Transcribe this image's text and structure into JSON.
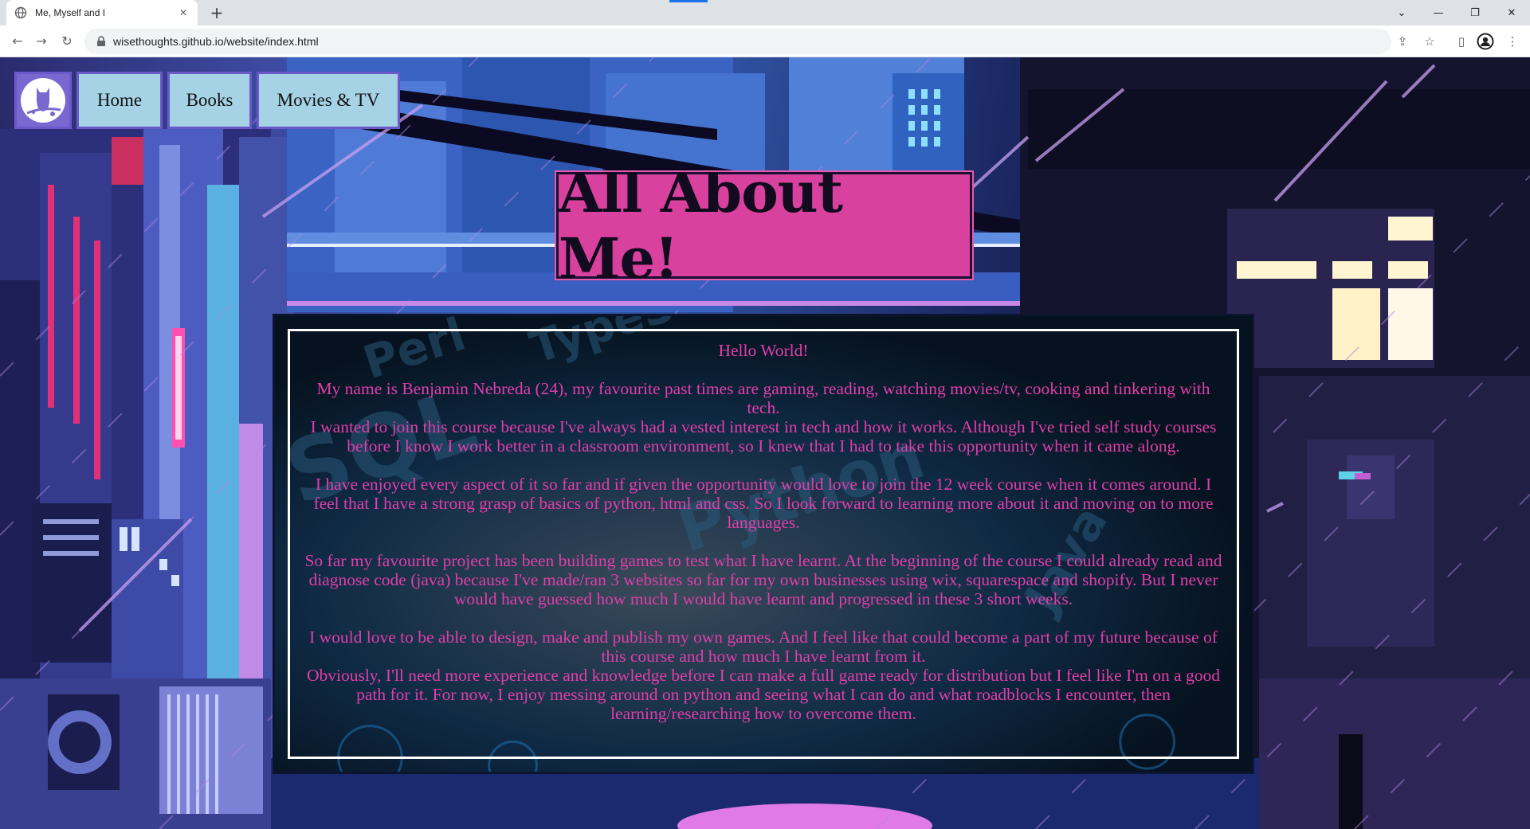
{
  "browser": {
    "tab_title": "Me, Myself and I",
    "tab_close_glyph": "✕",
    "new_tab_glyph": "+",
    "url": "wisethoughts.github.io/website/index.html",
    "window_controls": [
      "⌄",
      "—",
      "❐",
      "✕"
    ],
    "nav_glyphs": {
      "back": "←",
      "forward": "→",
      "reload": "↻"
    },
    "toolbar_glyphs": {
      "share": "⇪",
      "bookmark": "☆",
      "sidepanel": "▯",
      "menu": "⋮"
    }
  },
  "nav": {
    "logo_icon": "owl-icon",
    "items": [
      {
        "label": "Home"
      },
      {
        "label": "Books"
      },
      {
        "label": "Movies & TV"
      }
    ]
  },
  "header": {
    "title": "All About Me!"
  },
  "content": {
    "greeting": "Hello World!",
    "p1a": "My name is Benjamin Nebreda (24), my favourite past times are gaming, reading, watching movies/tv, cooking and tinkering with tech.",
    "p1b": "I wanted to join this course because I've always had a vested interest in tech and how it works. Although I've tried self study courses before I know I work better in a classroom environment, so I knew that I had to take this opportunity when it came along.",
    "p2": "I have enjoyed every aspect of it so far and if given the opportunity would love to join the 12 week course when it comes around. I feel that I have a strong grasp of basics of python, html and css. So I look forward to learning more about it and moving on to more languages.",
    "p3": "So far my favourite project has been building games to test what I have learnt. At the beginning of the course I could already read and diagnose code (java) because I've made/ran 3 websites so far for my own businesses using wix, squarespace and shopify. But I never would have guessed how much I would have learnt and progressed in these 3 short weeks.",
    "p4a": "I would love to be able to design, make and publish my own games. And I feel like that could become a part of my future because of this course and how much I have learnt from it.",
    "p4b": "Obviously, I'll need more experience and knowledge before I can make a full game ready for distribution but I feel like I'm on a good path for it. For now, I enjoy messing around on python and seeing what I can do and what roadblocks I encounter, then learning/researching how to overcome them."
  },
  "card_watermark_words": [
    "Perl",
    "TypeScript",
    "SQL",
    "Python",
    "Java"
  ],
  "colors": {
    "nav_bg": "#a6d2e6",
    "nav_border": "#6b58c9",
    "title_bg": "#d8419d",
    "text_pink": "#e03fa8",
    "card_bg": "#0a1426"
  }
}
